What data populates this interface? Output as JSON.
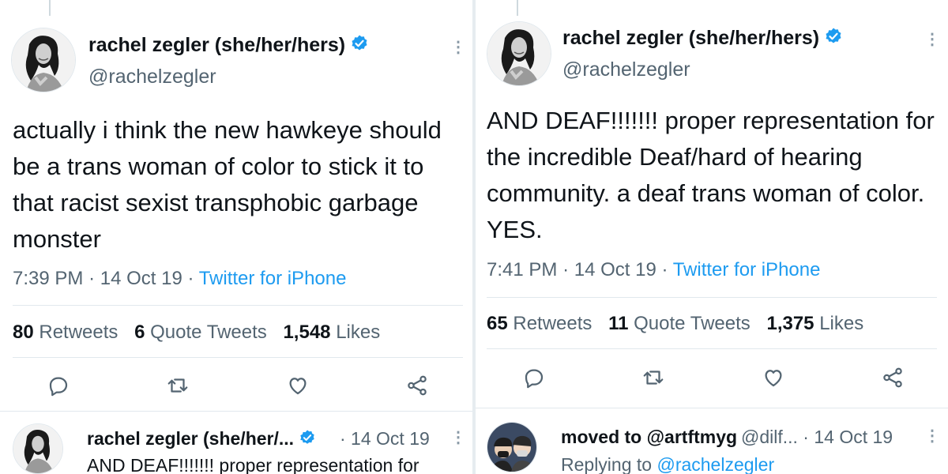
{
  "left": {
    "tweet": {
      "name": "rachel zegler (she/her/hers)",
      "handle": "@rachelzegler",
      "text": "actually i think the new hawkeye should be a trans woman of color to stick it to that racist sexist transphobic garbage monster",
      "time": "7:39 PM",
      "date": "14 Oct 19",
      "source": "Twitter for iPhone",
      "retweets": "80",
      "retweets_label": "Retweets",
      "quotes": "6",
      "quotes_label": "Quote Tweets",
      "likes": "1,548",
      "likes_label": "Likes",
      "dot": "·"
    },
    "reply": {
      "name": "rachel zegler (she/her/...",
      "date": "· 14 Oct 19",
      "text": "AND DEAF!!!!!!! proper representation for"
    }
  },
  "right": {
    "tweet": {
      "name": "rachel zegler (she/her/hers)",
      "handle": "@rachelzegler",
      "text": "AND DEAF!!!!!!! proper representation for the incredible Deaf/hard of hearing community. a deaf trans woman of color. YES.",
      "time": "7:41 PM",
      "date": "14 Oct 19",
      "source": "Twitter for iPhone",
      "retweets": "65",
      "retweets_label": "Retweets",
      "quotes": "11",
      "quotes_label": "Quote Tweets",
      "likes": "1,375",
      "likes_label": "Likes",
      "dot": "·"
    },
    "reply": {
      "name": "moved to @artftmyg",
      "handle_date": "@dilf... · 14 Oct 19",
      "replying_prefix": "Replying to",
      "replying_to": "@rachelzegler"
    }
  },
  "icons": {
    "verified_color": "#1d9bf0",
    "icon_color": "#536471",
    "more_glyph": "⋮"
  }
}
